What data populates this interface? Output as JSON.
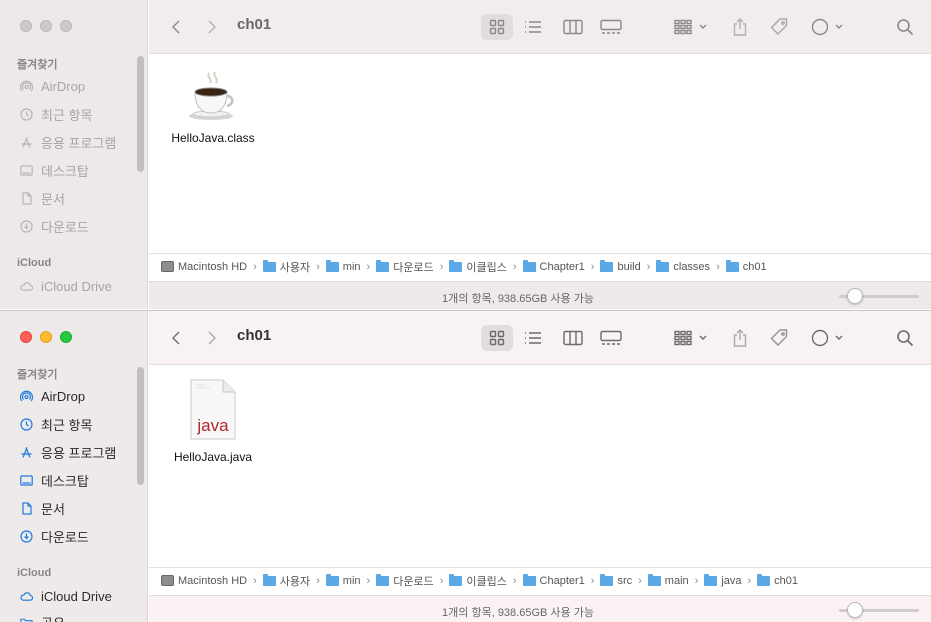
{
  "windows": [
    {
      "title": "ch01",
      "sidebar": {
        "favorites_label": "즐겨찾기",
        "items": [
          {
            "label": "AirDrop",
            "icon": "airdrop-icon"
          },
          {
            "label": "최근 항목",
            "icon": "clock-icon"
          },
          {
            "label": "응용 프로그램",
            "icon": "applications-icon"
          },
          {
            "label": "데스크탑",
            "icon": "desktop-icon"
          },
          {
            "label": "문서",
            "icon": "document-icon"
          },
          {
            "label": "다운로드",
            "icon": "download-icon"
          }
        ],
        "icloud_label": "iCloud",
        "icloud_items": [
          {
            "label": "iCloud Drive",
            "icon": "cloud-icon"
          }
        ]
      },
      "files": [
        {
          "name": "HelloJava.class",
          "icon": "java-coffee-icon"
        }
      ],
      "path": [
        "Macintosh HD",
        "사용자",
        "min",
        "다운로드",
        "이클립스",
        "Chapter1",
        "build",
        "classes",
        "ch01"
      ],
      "status": "1개의 항목, 938.65GB 사용 가능",
      "zoom_fraction": 0.2
    },
    {
      "title": "ch01",
      "sidebar": {
        "favorites_label": "즐겨찾기",
        "items": [
          {
            "label": "AirDrop",
            "icon": "airdrop-icon"
          },
          {
            "label": "최근 항목",
            "icon": "clock-icon"
          },
          {
            "label": "응용 프로그램",
            "icon": "applications-icon"
          },
          {
            "label": "데스크탑",
            "icon": "desktop-icon"
          },
          {
            "label": "문서",
            "icon": "document-icon"
          },
          {
            "label": "다운로드",
            "icon": "download-icon"
          }
        ],
        "icloud_label": "iCloud",
        "icloud_items": [
          {
            "label": "iCloud Drive",
            "icon": "cloud-icon"
          },
          {
            "label": "공유",
            "icon": "shared-folder-icon"
          }
        ]
      },
      "files": [
        {
          "name": "HelloJava.java",
          "icon": "java-file-icon",
          "badge": "java"
        }
      ],
      "path": [
        "Macintosh HD",
        "사용자",
        "min",
        "다운로드",
        "이클립스",
        "Chapter1",
        "src",
        "main",
        "java",
        "ch01"
      ],
      "status": "1개의 항목, 938.65GB 사용 가능",
      "zoom_fraction": 0.2
    }
  ],
  "colors": {
    "accent": "#1f7ae0",
    "folder": "#5aa8e6",
    "java_red": "#b3262b"
  }
}
